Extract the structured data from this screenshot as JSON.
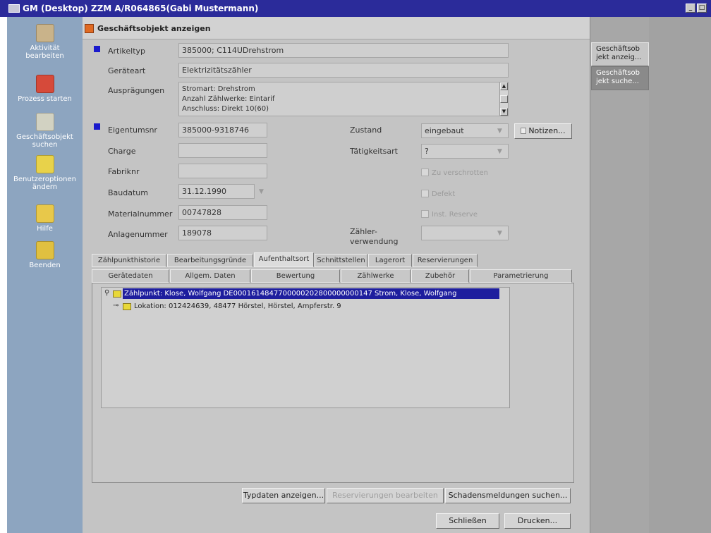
{
  "window": {
    "title": "GM (Desktop) ZZM A/R064865(Gabi Mustermann)",
    "minimize_glyph": "_",
    "maximize_glyph": "□"
  },
  "launcher": {
    "items": [
      {
        "label": "Aktivität bearbeiten",
        "icon": "activity-icon",
        "color": "#c9b38a"
      },
      {
        "label": "Prozess starten",
        "icon": "process-start-icon",
        "color": "#d64a3a"
      },
      {
        "label": "Geschäftsobjekt suchen",
        "icon": "business-object-search-icon",
        "color": "#d2d2c2"
      },
      {
        "label": "Benutzeroptionen ändern",
        "icon": "user-options-icon",
        "color": "#e8d24a"
      },
      {
        "label": "Hilfe",
        "icon": "help-icon",
        "color": "#e8c84a"
      },
      {
        "label": "Beenden",
        "icon": "exit-icon",
        "color": "#e0c040"
      }
    ]
  },
  "right_tabs": [
    {
      "label": "Geschäftsob jekt anzeig..."
    },
    {
      "label": "Geschäftsob jekt suche..."
    }
  ],
  "header": {
    "title": "Geschäftsobjekt anzeigen",
    "icon": "business-object-icon"
  },
  "form": {
    "artikeltyp": {
      "label": "Artikeltyp",
      "value": "385000; C114UDrehstrom"
    },
    "geraeteart": {
      "label": "Geräteart",
      "value": "Elektrizitätszähler"
    },
    "auspraegungen": {
      "label": "Ausprägungen",
      "lines": [
        "Stromart: Drehstrom",
        "Anzahl Zählwerke: Eintarif",
        "Anschluss: Direkt 10(60)"
      ]
    },
    "eigentumsnr": {
      "label": "Eigentumsnr",
      "value": "385000-9318746"
    },
    "charge": {
      "label": "Charge",
      "value": ""
    },
    "fabriknr": {
      "label": "Fabriknr",
      "value": ""
    },
    "baudatum": {
      "label": "Baudatum",
      "value": "31.12.1990"
    },
    "materialnummer": {
      "label": "Materialnummer",
      "value": "00747828"
    },
    "anlagenummer": {
      "label": "Anlagenummer",
      "value": "189078"
    },
    "zustand": {
      "label": "Zustand",
      "value": "eingebaut"
    },
    "taetigkeitsart": {
      "label": "Tätigkeitsart",
      "value": "?"
    },
    "zaehlerverwendung": {
      "label_line1": "Zähler-",
      "label_line2": "verwendung",
      "value": ""
    },
    "notizen_button": "Notizen...",
    "checkboxes": {
      "zu_verschrotten": "Zu verschrotten",
      "defekt": "Defekt",
      "inst_reserve": "Inst. Reserve"
    }
  },
  "tabs": {
    "row1": [
      "Zählpunkthistorie",
      "Bearbeitungsgründe",
      "Aufenthaltsort",
      "Schnittstellen",
      "Lagerort",
      "Reservierungen"
    ],
    "row2": [
      "Gerätedaten",
      "Allgem. Daten",
      "Bewertung",
      "Zählwerke",
      "Zubehör",
      "Parametrierung"
    ],
    "active": "Aufenthaltsort"
  },
  "tree": {
    "node1": "Zählpunkt: Klose, Wolfgang DE0001614847700000202800000000147 Strom, Klose, Wolfgang",
    "node2": "Lokation:  012424639, 48477 Hörstel, Hörstel, Ampferstr. 9"
  },
  "buttons": {
    "typdaten": "Typdaten anzeigen...",
    "reservierungen": "Reservierungen bearbeiten",
    "schadensmeldungen": "Schadensmeldungen suchen...",
    "schliessen": "Schließen",
    "drucken": "Drucken..."
  }
}
